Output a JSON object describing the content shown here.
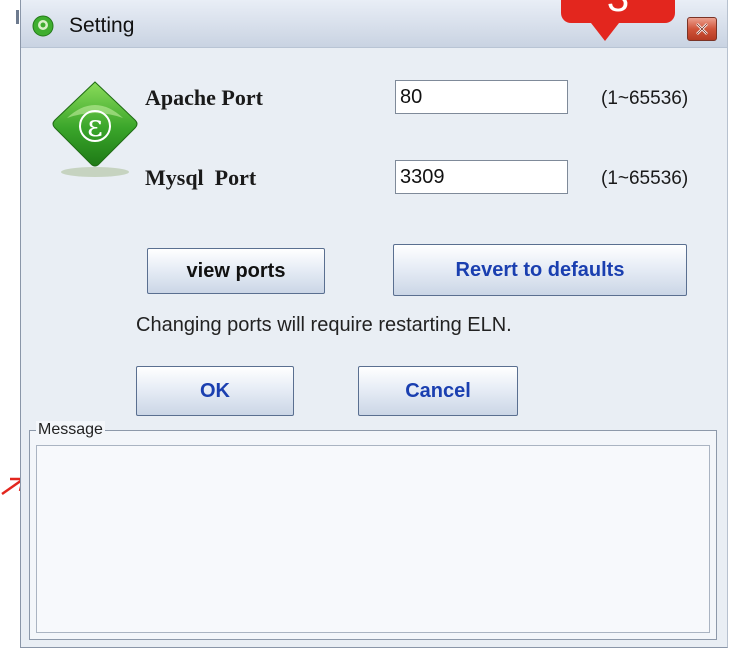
{
  "window": {
    "title": "Setting",
    "close_label": "close"
  },
  "callout": {
    "number": "3",
    "color": "#e3261e"
  },
  "form": {
    "apache_label": "Apache Port",
    "apache_value": "80",
    "apache_range": "(1~65536)",
    "mysql_label": "Mysql  Port",
    "mysql_value": "3309",
    "mysql_range": "(1~65536)"
  },
  "buttons": {
    "view_ports": "view ports",
    "revert": "Revert to defaults",
    "ok": "OK",
    "cancel": "Cancel"
  },
  "note": "Changing ports will require restarting ELN.",
  "message": {
    "legend": "Message",
    "content": ""
  },
  "icons": {
    "title": "eln-app-icon",
    "logo": "eln-logo-icon",
    "close": "close-icon",
    "arrow": "annotation-arrow-icon"
  },
  "colors": {
    "accent_text": "#1a3fb0",
    "annotation": "#e3261e",
    "logo_green": "#3fae2f"
  }
}
